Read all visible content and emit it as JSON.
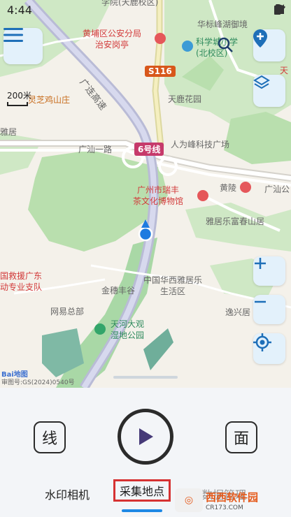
{
  "status_bar": {
    "time": "4:44"
  },
  "map": {
    "scale_label": "200米",
    "road_labels": {
      "guangshen_expressway": "广连高速",
      "guangshan_road_1": "广汕一路",
      "guangshan_road_2": "广汕公",
      "line_6": "6号线",
      "s116": "S116"
    },
    "pois": {
      "school_top": "学院(天鹿校区)",
      "police": "黄埔区公安分局\n治安岗亭",
      "kexuecheng_school": "科学城小学\n(北校区)",
      "huabiao": "华标峰湖御境",
      "tianlu_garden": "天鹿花园",
      "lingzhi_mountain": "灵芝鸡山庄",
      "renwei_science": "人为峰科技广场",
      "huangling": "黄陵",
      "ruifeng_museum": "广州市瑞丰\n茶文化博物馆",
      "yaju_mountain": "雅居乐富春山居",
      "rescue_team": "国救援广东\n动专业支队",
      "jinsui": "金穗丰谷",
      "huaxi_living": "中国华西雅居乐\n生活区",
      "wangyi": "网易总部",
      "yixing": "逸兴居",
      "tianhe_park": "天河大观\n湿地公园",
      "ya_left": "雅居",
      "tian_right": "天",
      "map_copyright": "审图号:GS(2024)0540号",
      "baidu_logo": "Bai地图"
    },
    "colors": {
      "map_bg": "#f4f1ea",
      "green_area": "#b9dfae",
      "road": "#d5d2cb",
      "expressway": "#c9cbe3",
      "location_dot": "#1e7be0",
      "accent_red": "#d63232",
      "accent_blue": "#1e88e5"
    }
  },
  "panel": {
    "line_button": "线",
    "area_button": "面",
    "play_icon": "play-icon",
    "tabs": [
      "水印相机",
      "采集地点",
      "数据管理"
    ],
    "active_tab_index": 1
  },
  "watermark": {
    "brand": "西西软件园",
    "site": "CR173.COM"
  }
}
